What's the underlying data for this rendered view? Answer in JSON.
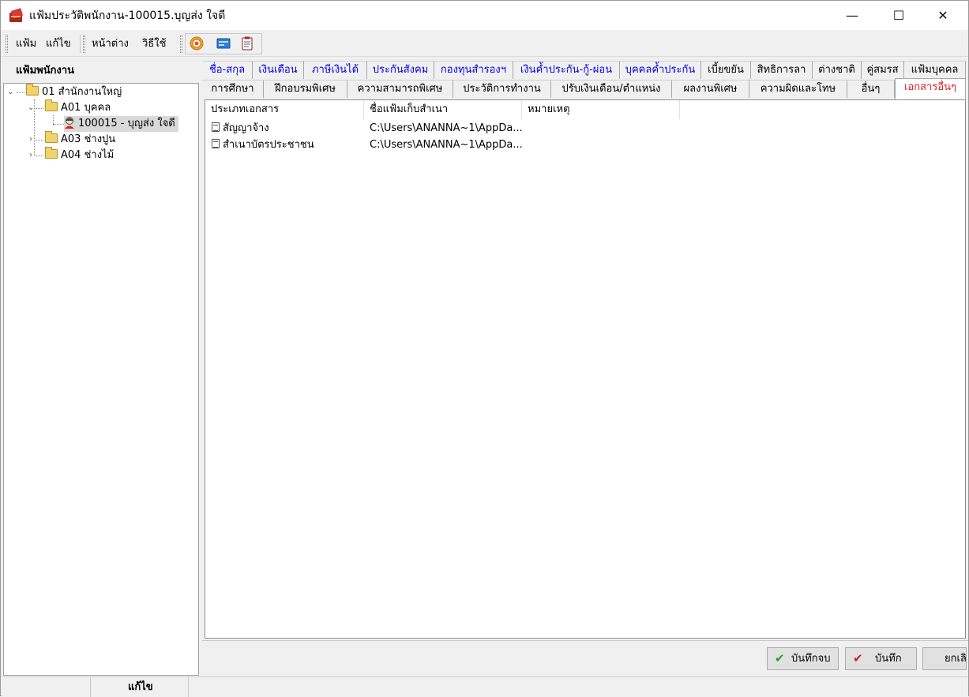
{
  "window": {
    "title": "แฟ้มประวัติพนักงาน-100015.บุญส่ง ใจดี",
    "minimize": "—",
    "maximize": "☐",
    "close": "✕"
  },
  "menu": {
    "file": "แฟ้ม",
    "edit": "แก้ไข",
    "window": "หน้าต่าง",
    "help": "วิธีใช้"
  },
  "toolbar_icons": [
    "target-icon",
    "card-icon",
    "clipboard-icon"
  ],
  "left_panel": {
    "header": "แฟ้มพนักงาน",
    "tree": [
      {
        "label": "01 สำนักงานใหญ่"
      },
      {
        "label": "A01 บุคคล"
      },
      {
        "label": "100015 - บุญส่ง ใจดี"
      },
      {
        "label": "A03 ช่างปูน"
      },
      {
        "label": "A04 ช่างไม้"
      }
    ]
  },
  "tabs_row1": [
    "ชื่อ-สกุล",
    "เงินเดือน",
    "ภาษีเงินได้",
    "ประกันสังคม",
    "กองทุนสำรองฯ",
    "เงินค้ำประกัน-กู้-ผ่อน",
    "บุคคลค้ำประกัน",
    "เบี้ยขยัน",
    "สิทธิการลา",
    "ต่างชาติ",
    "คู่สมรส",
    "แฟ้มบุคคล"
  ],
  "tabs_row2": [
    "การศึกษา",
    "ฝึกอบรมพิเศษ",
    "ความสามารถพิเศษ",
    "ประวัติการทำงาน",
    "ปรับเงินเดือน/ตำแหน่ง",
    "ผลงานพิเศษ",
    "ความผิดและโทษ",
    "อื่นๆ",
    "เอกสารอื่นๆ"
  ],
  "table": {
    "columns": [
      "ประเภทเอกสาร",
      "ชื่อแฟ้มเก็บสำเนา",
      "หมายเหตุ"
    ],
    "rows": [
      {
        "type": "สัญญาจ้าง",
        "file": "C:\\Users\\ANANNA~1\\AppDa...",
        "note": ""
      },
      {
        "type": "สำเนาบัตรประชาชน",
        "file": "C:\\Users\\ANANNA~1\\AppDa...",
        "note": ""
      }
    ]
  },
  "buttons": {
    "save_close": "บันทึกจบ",
    "save": "บันทึก",
    "cancel": "ยกเลิ"
  },
  "status": {
    "mode": "แก้ไข"
  },
  "colors": {
    "link_tab": "#0000ee",
    "active_tab": "#e0202a",
    "save_check": "#2e9d2e",
    "save_check2": "#c0202a"
  }
}
